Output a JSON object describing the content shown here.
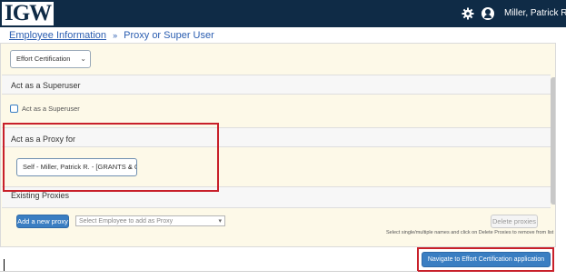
{
  "header": {
    "logo_text": "IGW",
    "settings_icon": "gear-icon",
    "user_icon": "user-circle-icon",
    "user_name": "Miller, Patrick R."
  },
  "breadcrumb": {
    "link_label": "Employee Information",
    "separator": "»",
    "current": "Proxy or Super User"
  },
  "application_select": {
    "value": "Effort Certification"
  },
  "superuser": {
    "title": "Act as a Superuser",
    "checkbox_label": "Act as a Superuser",
    "checked": false
  },
  "proxy": {
    "title": "Act as a Proxy for",
    "selected": "Self - Miller, Patrick R. - [GRANTS & CONTF"
  },
  "existing_proxies": {
    "title": "Existing Proxies",
    "add_button": "Add a new proxy",
    "employee_placeholder": "Select Employee to add as Proxy",
    "delete_button": "Delete proxies",
    "hint": "Select single/multiple names and click on Delete Proxies to remove from list"
  },
  "navigate_button": "Navigate to Effort Certification application",
  "colors": {
    "header_bg": "#0f2b46",
    "accent_blue": "#3a7ec2",
    "panel_bg": "#fdf9e8",
    "highlight_red": "#c8202a"
  }
}
